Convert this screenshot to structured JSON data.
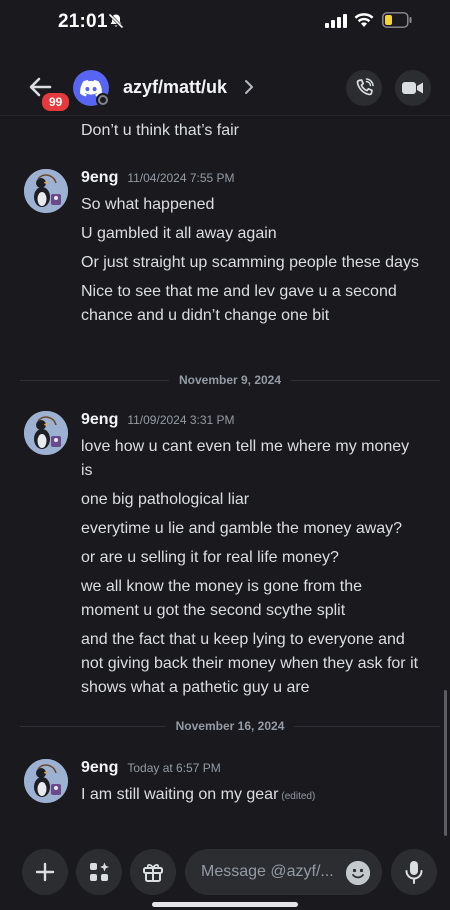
{
  "status_bar": {
    "time": "21:01",
    "battery_color": "#f7d33a"
  },
  "header": {
    "unread_badge": "99",
    "title": "azyf/matt/uk",
    "icons": [
      "back-arrow-icon",
      "discord-logo-icon",
      "chevron-right-icon",
      "phone-icon",
      "video-camera-icon"
    ]
  },
  "previous_message": {
    "text": "Don’t u think that’s fair"
  },
  "messages": [
    {
      "author": "9eng",
      "timestamp": "11/04/2024 7:55 PM",
      "lines": [
        "So what happened",
        "U gambled it all away again",
        "Or just straight up scamming people these days",
        "Nice to see that me and lev gave u a second chance and u didn’t change one bit"
      ]
    },
    {
      "author": "9eng",
      "timestamp": "11/09/2024 3:31 PM",
      "lines": [
        "love how u cant even tell me where my money is",
        "one big pathological liar",
        "everytime u lie and gamble the money away?",
        "or are u selling it for real life money?",
        "we all know the money is gone from the moment u got the second scythe split",
        "and the fact that u keep lying to everyone and not giving back their money when they ask for it shows what a pathetic guy u are"
      ]
    },
    {
      "author": "9eng",
      "timestamp": "Today at 6:57 PM",
      "lines": [
        "I am still waiting on my gear"
      ],
      "edited_label": "(edited)"
    }
  ],
  "dividers": [
    "November 9, 2024",
    "November 16, 2024"
  ],
  "composer": {
    "placeholder": "Message @azyf/...",
    "icons": [
      "plus-icon",
      "apps-icon",
      "gift-icon",
      "emoji-icon",
      "microphone-icon"
    ]
  },
  "colors": {
    "background": "#1a1a1e",
    "accent": "#5865f2",
    "badge": "#e5393d"
  }
}
